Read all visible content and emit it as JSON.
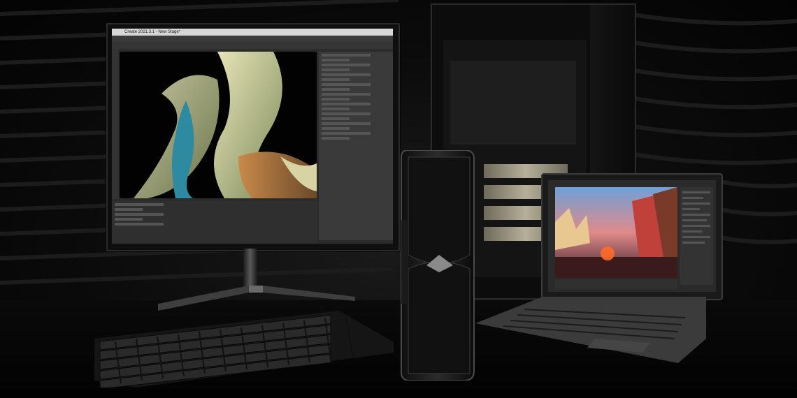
{
  "scene": {
    "title": "",
    "objects": [
      {
        "id": "monitor",
        "label": ""
      },
      {
        "id": "keyboard",
        "label": ""
      },
      {
        "id": "workstation-tower",
        "label": ""
      },
      {
        "id": "graphics-card",
        "label": ""
      },
      {
        "id": "laptop",
        "label": ""
      }
    ]
  },
  "monitor_app": {
    "window_title": "Create 2021.3.1 - New Stage*"
  },
  "colors": {
    "background": "#050505",
    "stripe": "#1c1c1c",
    "device_body": "#0f0f0f",
    "gpu_slot_gold": "#b6b09a",
    "sunset_red": "#c0403a",
    "sky_blue": "#6fa0d8"
  }
}
